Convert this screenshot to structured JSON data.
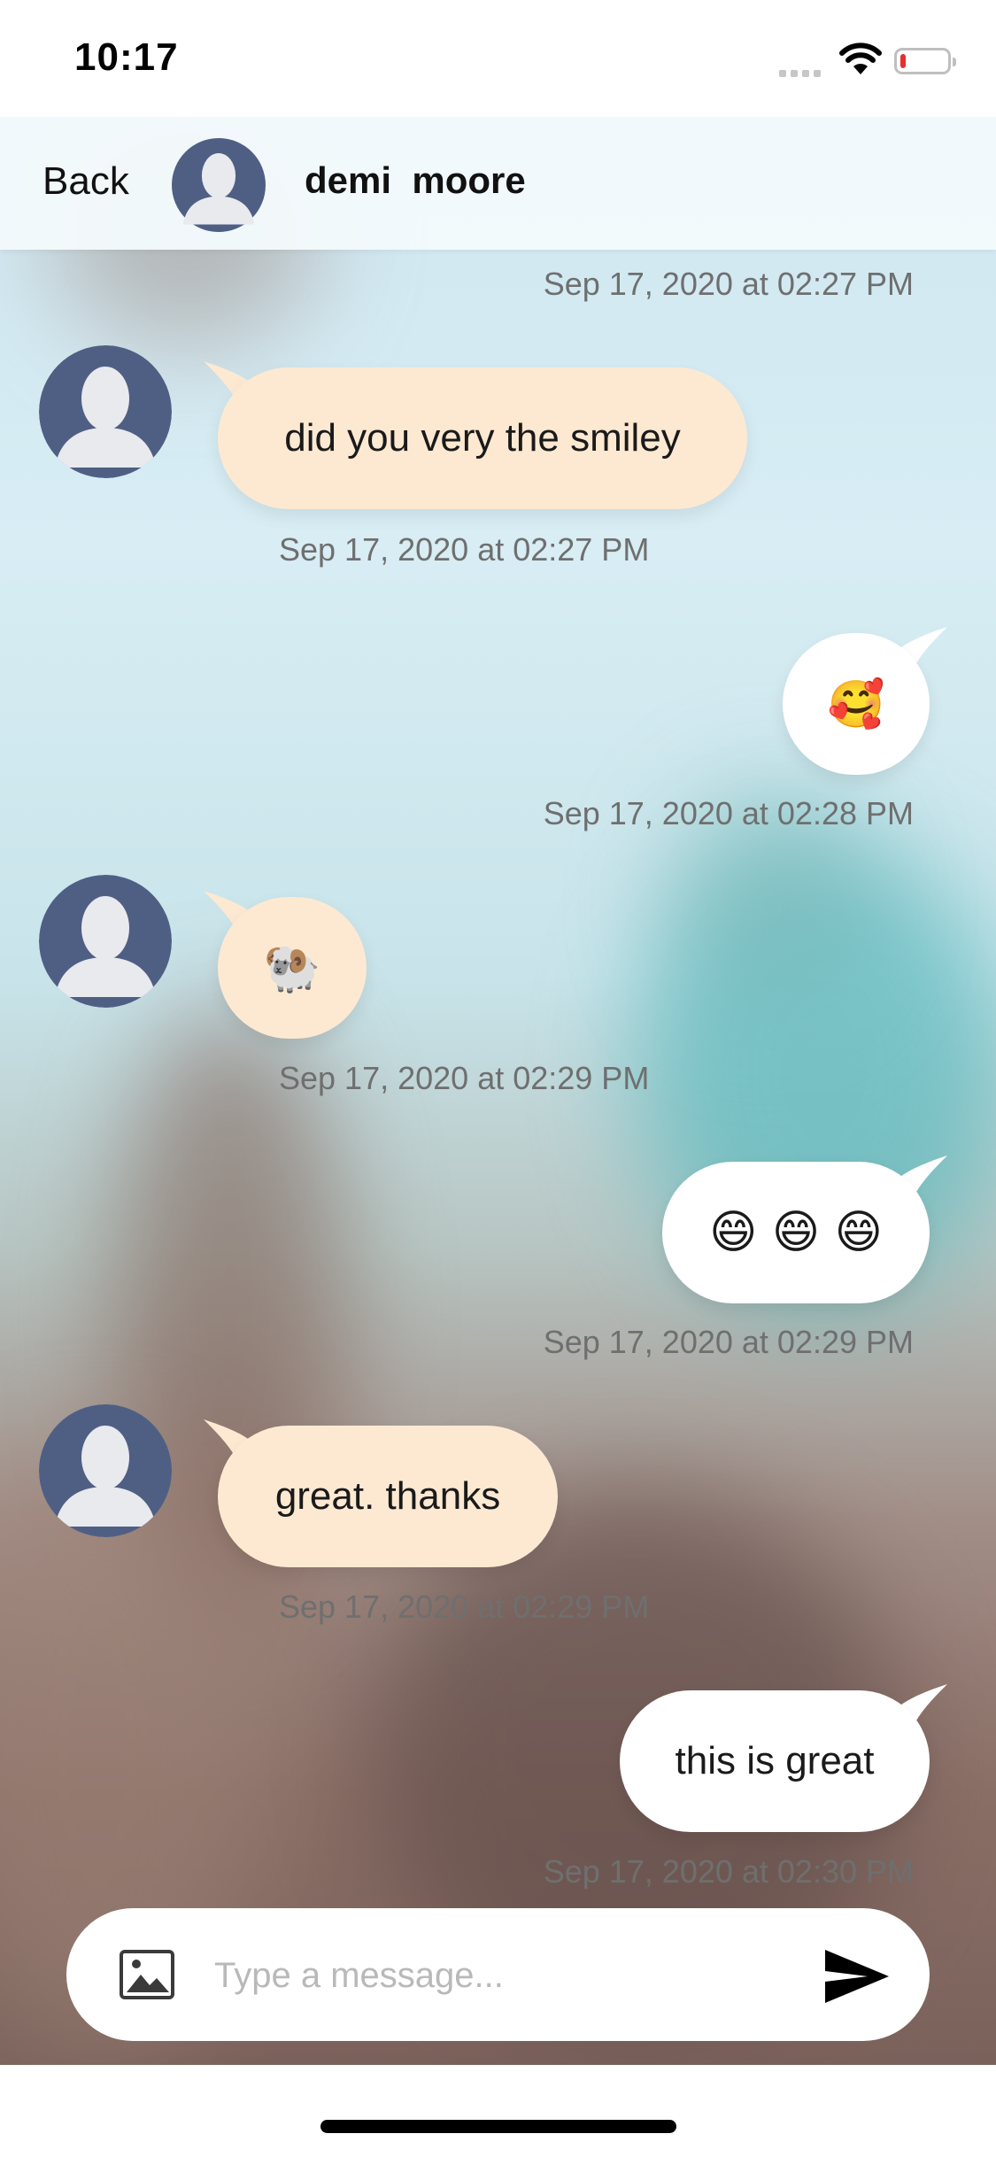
{
  "status_bar": {
    "time": "10:17"
  },
  "header": {
    "back_label": "Back",
    "contact_name": "demi  moore"
  },
  "messages": [
    {
      "timestamp": "Sep 17, 2020 at 02:27 PM"
    },
    {
      "direction": "incoming",
      "text": "did you very the smiley",
      "timestamp": "Sep 17, 2020 at 02:27 PM"
    },
    {
      "direction": "outgoing",
      "text": "🥰",
      "timestamp": "Sep 17, 2020 at 02:28 PM"
    },
    {
      "direction": "incoming",
      "text": "🐏",
      "timestamp": "Sep 17, 2020 at 02:29 PM"
    },
    {
      "direction": "outgoing",
      "text": "😄 😄 😄",
      "timestamp": "Sep 17, 2020 at 02:29 PM"
    },
    {
      "direction": "incoming",
      "text": "great. thanks",
      "timestamp": "Sep 17, 2020 at 02:29 PM"
    },
    {
      "direction": "outgoing",
      "text": "this is great",
      "timestamp": "Sep 17, 2020 at 02:30 PM"
    }
  ],
  "composer": {
    "placeholder": "Type a message..."
  },
  "colors": {
    "incoming_bubble": "#fde9d2",
    "outgoing_bubble": "#ffffff",
    "avatar": "#4f5f84"
  },
  "icons": [
    "image-icon",
    "send-icon",
    "wifi-icon",
    "battery-icon",
    "avatar-icon"
  ]
}
